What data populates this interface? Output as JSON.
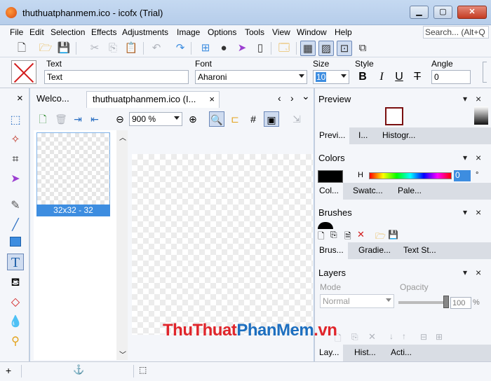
{
  "window": {
    "title": "thuthuatphanmem.ico - icofx (Trial)"
  },
  "menu": [
    "File",
    "Edit",
    "Selection",
    "Effects",
    "Adjustments",
    "Image",
    "Options",
    "Tools",
    "View",
    "Window",
    "Help"
  ],
  "search": {
    "value": "Search... (Alt+Q"
  },
  "options": {
    "text_label": "Text",
    "text_value": "Text",
    "font_label": "Font",
    "font_value": "Aharoni",
    "size_label": "Size",
    "size_value": "10",
    "style_label": "Style",
    "bold": "B",
    "italic": "I",
    "underline": "U",
    "strike": "T",
    "angle_label": "Angle",
    "angle_value": "0"
  },
  "doc_tabs": {
    "close": "×",
    "welcome": "Welco...",
    "doc": "thuthuatphanmem.ico (I...",
    "nav_left": "‹",
    "nav_right": "›",
    "nav_menu": "⌄"
  },
  "doc_toolbar": {
    "zoom": "900 %"
  },
  "thumb": {
    "label": "32x32 - 32"
  },
  "panels": {
    "preview": {
      "title": "Preview",
      "tabs": [
        "Previ...",
        "I...",
        "Histogr..."
      ]
    },
    "colors": {
      "title": "Colors",
      "channel": "H",
      "value": "0",
      "unit": "°",
      "tabs": [
        "Col...",
        "Swatc...",
        "Pale..."
      ]
    },
    "brushes": {
      "title": "Brushes",
      "tabs": [
        "Brus...",
        "Gradie...",
        "Text St..."
      ]
    },
    "layers": {
      "title": "Layers",
      "mode_label": "Mode",
      "mode_value": "Normal",
      "opacity_label": "Opacity",
      "opacity_value": "100",
      "opacity_unit": "%",
      "tabs": [
        "Lay...",
        "Hist...",
        "Acti..."
      ]
    }
  },
  "panel_controls": {
    "menu": "▾",
    "close": "×"
  },
  "watermark": {
    "part1": "ThuThuat",
    "part2": "PhanMem",
    "part3": ".vn"
  },
  "colors_theme": {
    "accent": "#3d8de0",
    "watermark_red": "#e0252b",
    "watermark_blue": "#1d6fc0"
  }
}
